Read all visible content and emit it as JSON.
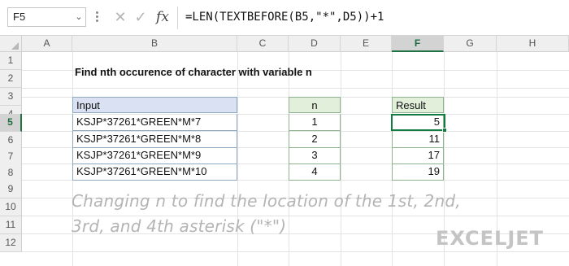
{
  "name_box": "F5",
  "name_box_arrow": "⌄",
  "formula_bar": {
    "cancel_icon": "✕",
    "enter_icon": "✓",
    "fx_label": "fx",
    "formula": "=LEN(TEXTBEFORE(B5,\"*\",D5))+1"
  },
  "columns": [
    "A",
    "B",
    "C",
    "D",
    "E",
    "F",
    "G",
    "H"
  ],
  "selected_column": "F",
  "rows": [
    "1",
    "2",
    "3",
    "4",
    "5",
    "6",
    "7",
    "8",
    "9",
    "10",
    "11",
    "12"
  ],
  "selected_row": "5",
  "sheet": {
    "title": "Find nth occurence of character with variable n",
    "input_header": "Input",
    "n_header": "n",
    "result_header": "Result",
    "table": [
      {
        "input": "KSJP*37261*GREEN*M*7",
        "n": "1",
        "result": "5"
      },
      {
        "input": "KSJP*37261*GREEN*M*8",
        "n": "2",
        "result": "11"
      },
      {
        "input": "KSJP*37261*GREEN*M*9",
        "n": "3",
        "result": "17"
      },
      {
        "input": "KSJP*37261*GREEN*M*10",
        "n": "4",
        "result": "19"
      }
    ]
  },
  "caption_line1": "Changing n to find the location of the 1st, 2nd,",
  "caption_line2": "3rd, and 4th asterisk (\"*\")",
  "logo_text": "EXCELJET",
  "colors": {
    "accent_green": "#107c41",
    "header_blue": "#d9e1f2",
    "header_green": "#e2efda"
  }
}
